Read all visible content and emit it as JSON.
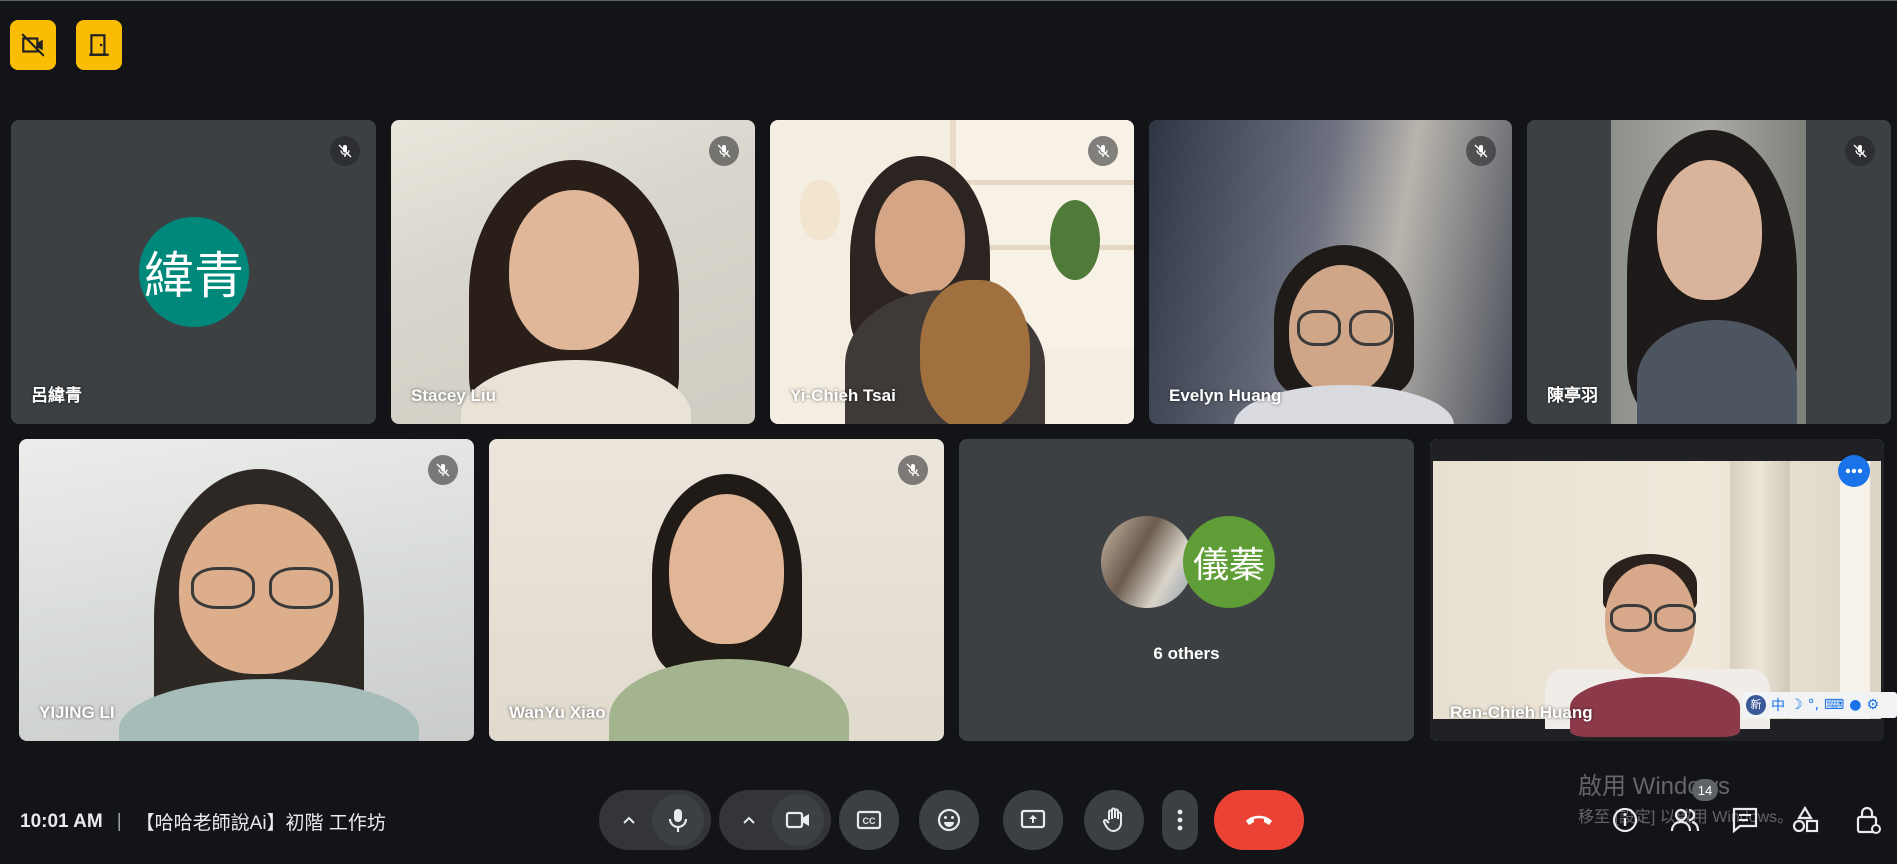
{
  "top_icons": [
    "no-video-icon",
    "door-exit-icon"
  ],
  "participants": [
    {
      "name": "呂緯青",
      "muted": true,
      "avatar_text": "緯青",
      "avatar_color": "#00897b"
    },
    {
      "name": "Stacey Liu",
      "muted": true
    },
    {
      "name": "Yi-Chieh Tsai",
      "muted": true
    },
    {
      "name": "Evelyn Huang",
      "muted": true
    },
    {
      "name": "陳亭羽",
      "muted": true
    },
    {
      "name": "YIJING LI",
      "muted": true
    },
    {
      "name": "WanYu Xiao",
      "muted": true
    },
    {
      "name": "Ren-Chieh Huang",
      "muted": false,
      "active": true
    }
  ],
  "others": {
    "label": "6 others",
    "avatar_text": "儀蓁",
    "avatar_color": "#5f9e36"
  },
  "meeting": {
    "time": "10:01 AM",
    "separator": "|",
    "title": "【哈哈老師說Ai】初階 工作坊"
  },
  "controls": [
    "chevron-up-icon",
    "microphone-icon",
    "chevron-up-icon",
    "camera-icon",
    "captions-icon",
    "emoji-icon",
    "present-screen-icon",
    "raise-hand-icon",
    "more-options-icon",
    "end-call-icon"
  ],
  "right_controls": [
    "info-icon",
    "people-icon",
    "chat-icon",
    "activities-icon",
    "host-controls-icon"
  ],
  "people_count": "14",
  "watermark": {
    "line1": "啟用 Windows",
    "line2": "移至 [設定] 以啟用 Windows。"
  },
  "ime_bar": {
    "mode": "中",
    "icons": [
      "moon-icon",
      "comma-icon",
      "keyboard-icon",
      "mic-icon",
      "gear-icon"
    ]
  },
  "colors": {
    "accent": "#8ab4f8",
    "end_call": "#ea4335",
    "top_icons": "#fbbc04",
    "tile_bg": "#3c4043"
  }
}
